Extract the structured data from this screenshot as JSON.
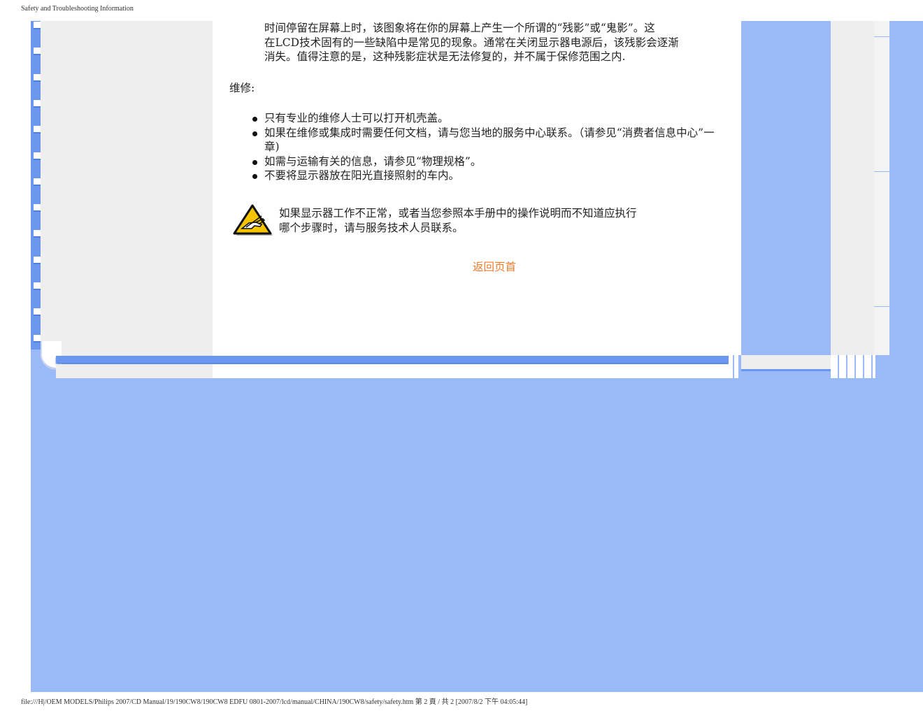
{
  "page": {
    "header_title": "Safety and Troubleshooting Information",
    "footer_path": "file:///H|/OEM MODELS/Philips 2007/CD Manual/19/190CW8/190CW8 EDFU 0801-2007/lcd/manual/CHINA/190CW8/safety/safety.htm 第 2 頁 / 共 2  [2007/8/2 下午 04:05:44]"
  },
  "content": {
    "para_lines": [
      "时间停留在屏幕上时，该图象将在你的屏幕上产生一个所谓的“残影”或“鬼影”。这",
      "在LCD技术固有的一些缺陷中是常见的现象。通常在关闭显示器电源后，该残影会逐渐",
      "消失。值得注意的是，这种残影症状是无法修复的，并不属于保修范围之内."
    ],
    "maintenance_label": "维修:",
    "bullets": [
      "只有专业的维修人士可以打开机壳盖。",
      "如果在维修或集成时需要任何文档，请与您当地的服务中心联系。（请参见“消费者信息中心”一章)",
      "如需与运输有关的信息，请参见“物理规格”。",
      "不要将显示器放在阳光直接照射的车内。"
    ],
    "warning_lines": [
      "如果显示器工作不正常，或者当您参照本手册中的操作说明而不知道应执行",
      "哪个步骤时，请与服务技术人员联系。"
    ],
    "warning_icon": "caution-hand-icon",
    "back_to_top": "返回页首"
  },
  "colors": {
    "frame_blue": "#9ab9f7",
    "rail_blue": "#6c97ee",
    "panel_gray": "#eeeeee",
    "link_orange": "#f07b2c"
  }
}
